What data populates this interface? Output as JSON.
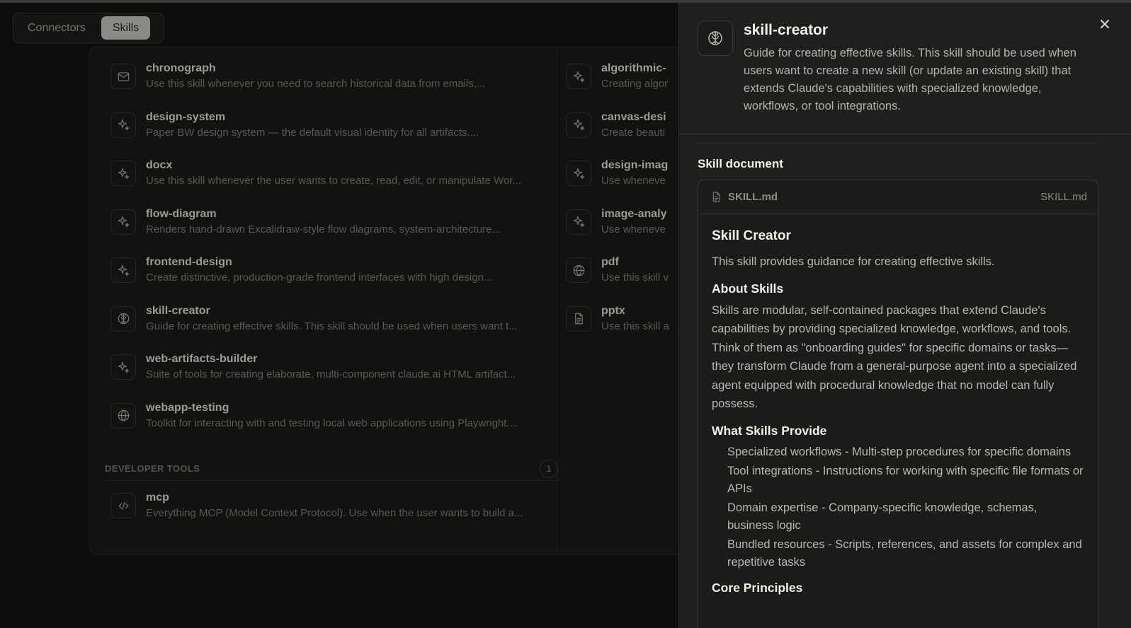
{
  "tabs": {
    "connectors": "Connectors",
    "skills": "Skills"
  },
  "skills_col1": [
    {
      "title": "chronograph",
      "desc": "Use this skill whenever you need to search historical data from emails,...",
      "icon": "mail-icon"
    },
    {
      "title": "design-system",
      "desc": "Paper BW design system — the default visual identity for all artifacts....",
      "icon": "sparkle-icon"
    },
    {
      "title": "docx",
      "desc": "Use this skill whenever the user wants to create, read, edit, or manipulate Wor...",
      "icon": "sparkle-icon"
    },
    {
      "title": "flow-diagram",
      "desc": "Renders hand-drawn Excalidraw-style flow diagrams, system-architecture...",
      "icon": "sparkle-icon"
    },
    {
      "title": "frontend-design",
      "desc": "Create distinctive, production-grade frontend interfaces with high design...",
      "icon": "sparkle-icon"
    },
    {
      "title": "skill-creator",
      "desc": "Guide for creating effective skills. This skill should be used when users want t...",
      "icon": "brain-icon"
    },
    {
      "title": "web-artifacts-builder",
      "desc": "Suite of tools for creating elaborate, multi-component claude.ai HTML artifact...",
      "icon": "sparkle-icon"
    },
    {
      "title": "webapp-testing",
      "desc": "Toolkit for interacting with and testing local web applications using Playwright....",
      "icon": "globe-icon"
    }
  ],
  "skills_col2": [
    {
      "title": "algorithmic-",
      "desc": "Creating algor",
      "icon": "sparkle-icon"
    },
    {
      "title": "canvas-desi",
      "desc": "Create beauti",
      "icon": "sparkle-icon"
    },
    {
      "title": "design-imag",
      "desc": "Use wheneve",
      "icon": "sparkle-icon"
    },
    {
      "title": "image-analy",
      "desc": "Use wheneve",
      "icon": "sparkle-icon"
    },
    {
      "title": "pdf",
      "desc": "Use this skill v",
      "icon": "globe-icon"
    },
    {
      "title": "pptx",
      "desc": "Use this skill a",
      "icon": "document-icon"
    }
  ],
  "developer_tools": {
    "label": "DEVELOPER TOOLS",
    "count": "1",
    "items": [
      {
        "title": "mcp",
        "desc": "Everything MCP (Model Context Protocol). Use when the user wants to build a...",
        "icon": "code-icon"
      }
    ]
  },
  "panel": {
    "title": "skill-creator",
    "description": "Guide for creating effective skills. This skill should be used when users want to create a new skill (or update an existing skill) that extends Claude's capabilities with specialized knowledge, workflows, or tool integrations.",
    "doc_heading": "Skill document",
    "file_name": "SKILL.md",
    "file_name_right": "SKILL.md",
    "doc": {
      "h1": "Skill Creator",
      "intro": "This skill provides guidance for creating effective skills.",
      "about_heading": "About Skills",
      "about_text": "Skills are modular, self-contained packages that extend Claude's capabilities by providing specialized knowledge, workflows, and tools. Think of them as \"onboarding guides\" for specific domains or tasks—they transform Claude from a general-purpose agent into a specialized agent equipped with procedural knowledge that no model can fully possess.",
      "provide_heading": "What Skills Provide",
      "provide_items": [
        "Specialized workflows - Multi-step procedures for specific domains",
        "Tool integrations - Instructions for working with specific file formats or APIs",
        "Domain expertise - Company-specific knowledge, schemas, business logic",
        "Bundled resources - Scripts, references, and assets for complex and repetitive tasks"
      ],
      "principles_heading": "Core Principles"
    }
  }
}
